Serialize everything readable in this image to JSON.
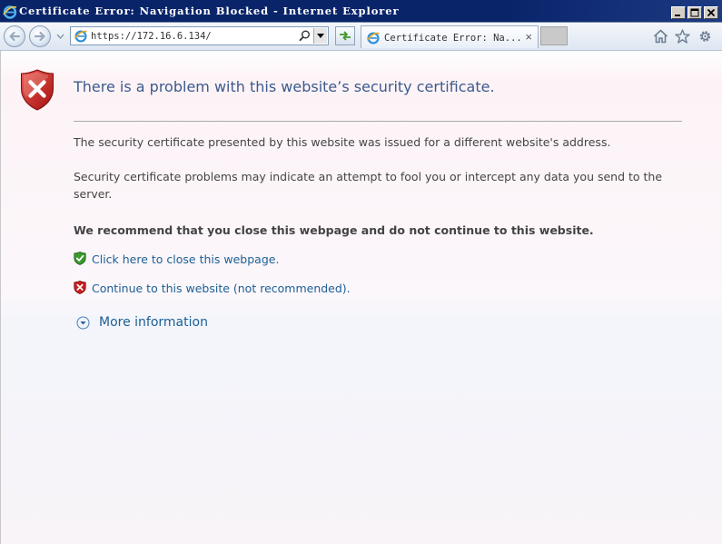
{
  "window": {
    "title": "Certificate Error: Navigation Blocked - Internet Explorer"
  },
  "toolbar": {
    "address_url": "https://172.16.6.134/",
    "tab_title": "Certificate Error: Na...",
    "tab_close": "×"
  },
  "page": {
    "heading": "There is a problem with this website’s security certificate.",
    "paragraph1": "The security certificate presented by this website was issued for a different website's address.",
    "paragraph2": "Security certificate problems may indicate an attempt to fool you or intercept any data you send to the server.",
    "recommendation": "We recommend that you close this webpage and do not continue to this website.",
    "close_link": "Click here to close this webpage.",
    "continue_link": "Continue to this website (not recommended).",
    "more_info": "More information"
  },
  "colors": {
    "titlebar": "#0a246a",
    "heading": "#3b5a8d",
    "link": "#1d5f94",
    "shield_red": "#c8201f",
    "shield_green": "#3a9a2e"
  }
}
